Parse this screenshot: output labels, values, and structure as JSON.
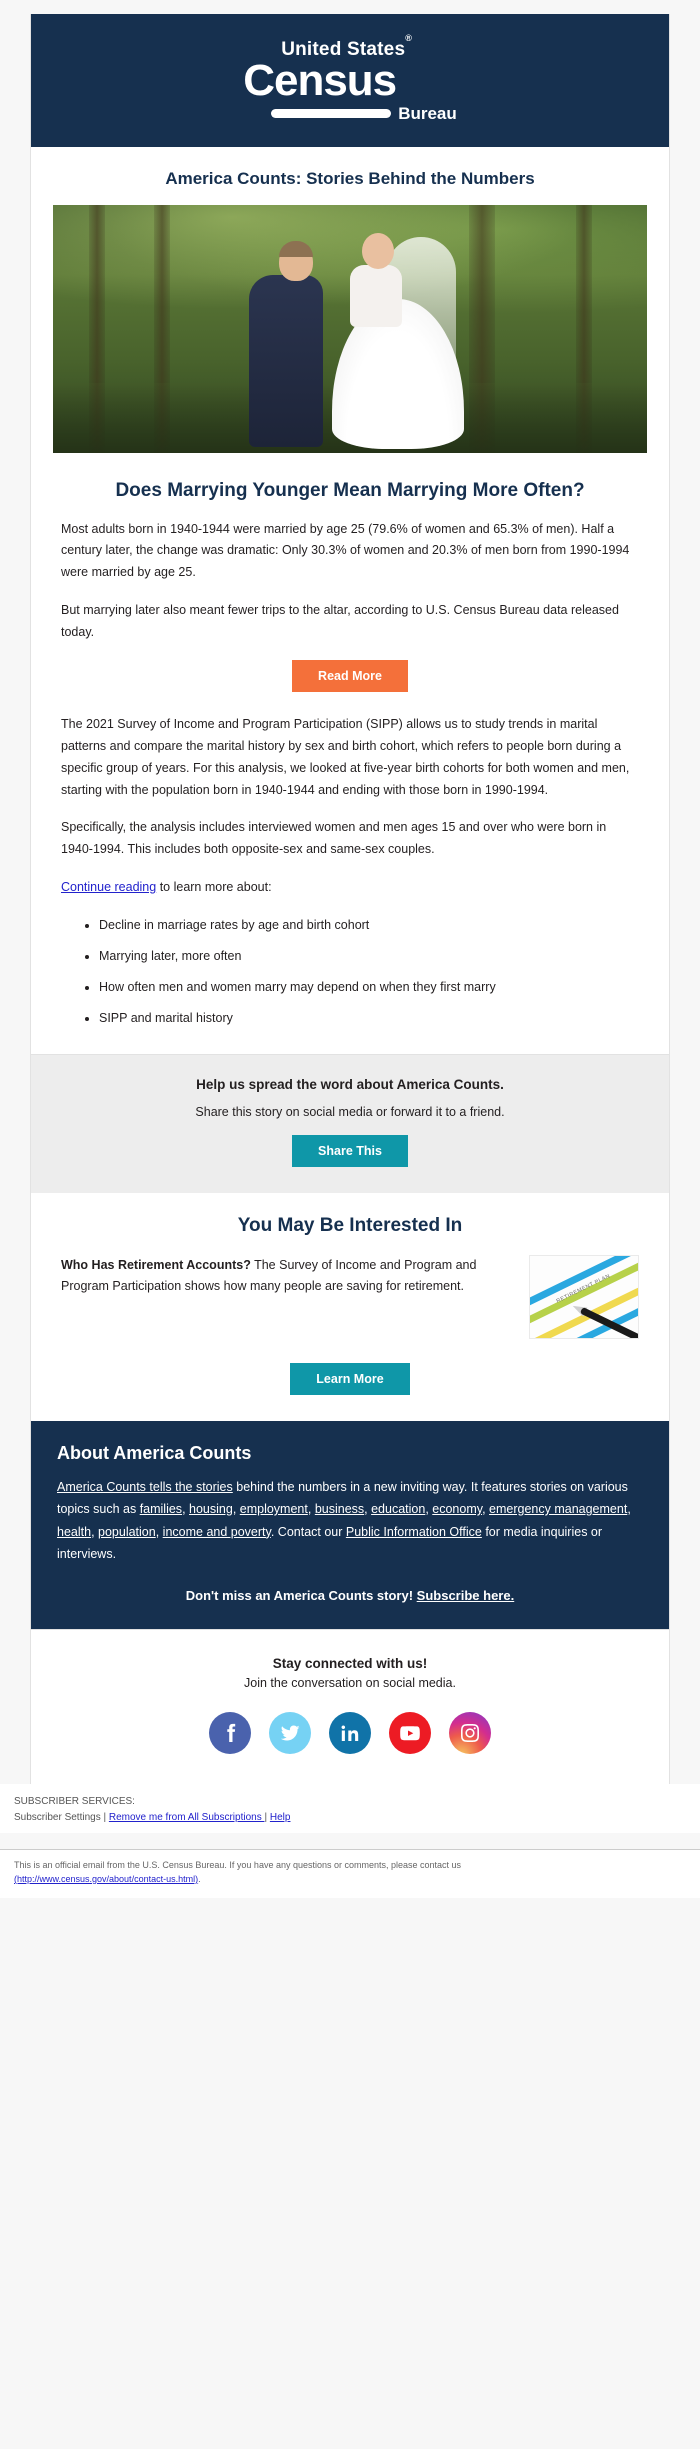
{
  "brand": {
    "logo_top": "United States",
    "logo_registered": "®",
    "logo_main": "Census",
    "logo_bottom": "Bureau",
    "navy": "#16304f",
    "orange": "#f4703a",
    "teal": "#0f97a8"
  },
  "newsletter": {
    "title": "America Counts: Stories Behind the Numbers"
  },
  "hero": {
    "alt": "Bride and groom standing forehead to forehead in a green forest"
  },
  "article": {
    "headline": "Does Marrying Younger Mean Marrying More Often?",
    "paragraph1": "Most adults born in 1940-1944 were married by age 25 (79.6% of women and 65.3% of men). Half a century later, the change was dramatic: Only 30.3% of women and 20.3% of men born from 1990-1994 were married by age 25.",
    "paragraph2": "But marrying later also meant fewer trips to the altar, according to U.S. Census Bureau data released today.",
    "read_more_label": "Read More",
    "paragraph3": "The 2021 Survey of Income and Program Participation (SIPP) allows us to study trends in marital patterns and compare the marital history by sex and birth cohort, which refers to people born during a specific group of years. For this analysis, we looked at five-year birth cohorts for both women and men, starting with the population born in 1940-1944 and ending with those born in 1990-1994.",
    "paragraph4": "Specifically, the analysis includes interviewed women and men ages 15 and over who were born in 1940-1994. This includes both opposite-sex and same-sex couples.",
    "continue_link": "Continue reading",
    "continue_tail": " to learn more about:",
    "bullets": [
      "Decline in marriage rates by age and birth cohort",
      "Marrying later, more often",
      "How often men and women marry may depend on when they first marry",
      "SIPP and marital history"
    ]
  },
  "share": {
    "heading": "Help us spread the word about America Counts.",
    "subtext": "Share this story on social media or forward it to a friend.",
    "button_label": "Share This"
  },
  "interested": {
    "heading": "You May Be Interested In",
    "promo_title": "Who Has Retirement Accounts?",
    "promo_body": " The Survey of Income and Program and Program Participation shows how many people are saving for retirement.",
    "promo_image_label": "RETIREMENT PLAN",
    "button_label": "Learn More"
  },
  "about": {
    "heading": "About America Counts",
    "lead_link": "America Counts tells the stories",
    "text1": " behind the numbers in a new inviting way. It features stories on various topics such as ",
    "topics": [
      "families",
      "housing",
      "employment",
      "business",
      "education",
      "economy",
      "emergency management",
      "health",
      "population",
      "income and poverty"
    ],
    "text2": ". Contact our ",
    "contact_link": "Public Information Office",
    "text3": " for media inquiries or interviews.",
    "cta_text": "Don't miss an America Counts story! ",
    "cta_link": "Subscribe here."
  },
  "social": {
    "heading": "Stay connected with us!",
    "subtext": "Join the conversation on social media.",
    "icons": [
      {
        "name": "facebook-icon",
        "label": "Facebook"
      },
      {
        "name": "twitter-icon",
        "label": "Twitter"
      },
      {
        "name": "linkedin-icon",
        "label": "LinkedIn"
      },
      {
        "name": "youtube-icon",
        "label": "YouTube"
      },
      {
        "name": "instagram-icon",
        "label": "Instagram"
      }
    ]
  },
  "footer": {
    "subscriber_services": "SUBSCRIBER SERVICES:",
    "settings_label": "Subscriber Settings",
    "sep1": "  |  ",
    "remove_label": "Remove me from All Subscriptions ",
    "sep2": "  |  ",
    "help_label": "Help",
    "legal_text": "This is an official email from the U.S. Census Bureau. If you have any questions or comments, please contact us",
    "legal_url": "(http://www.census.gov/about/contact-us.html)",
    "legal_tail": "."
  }
}
